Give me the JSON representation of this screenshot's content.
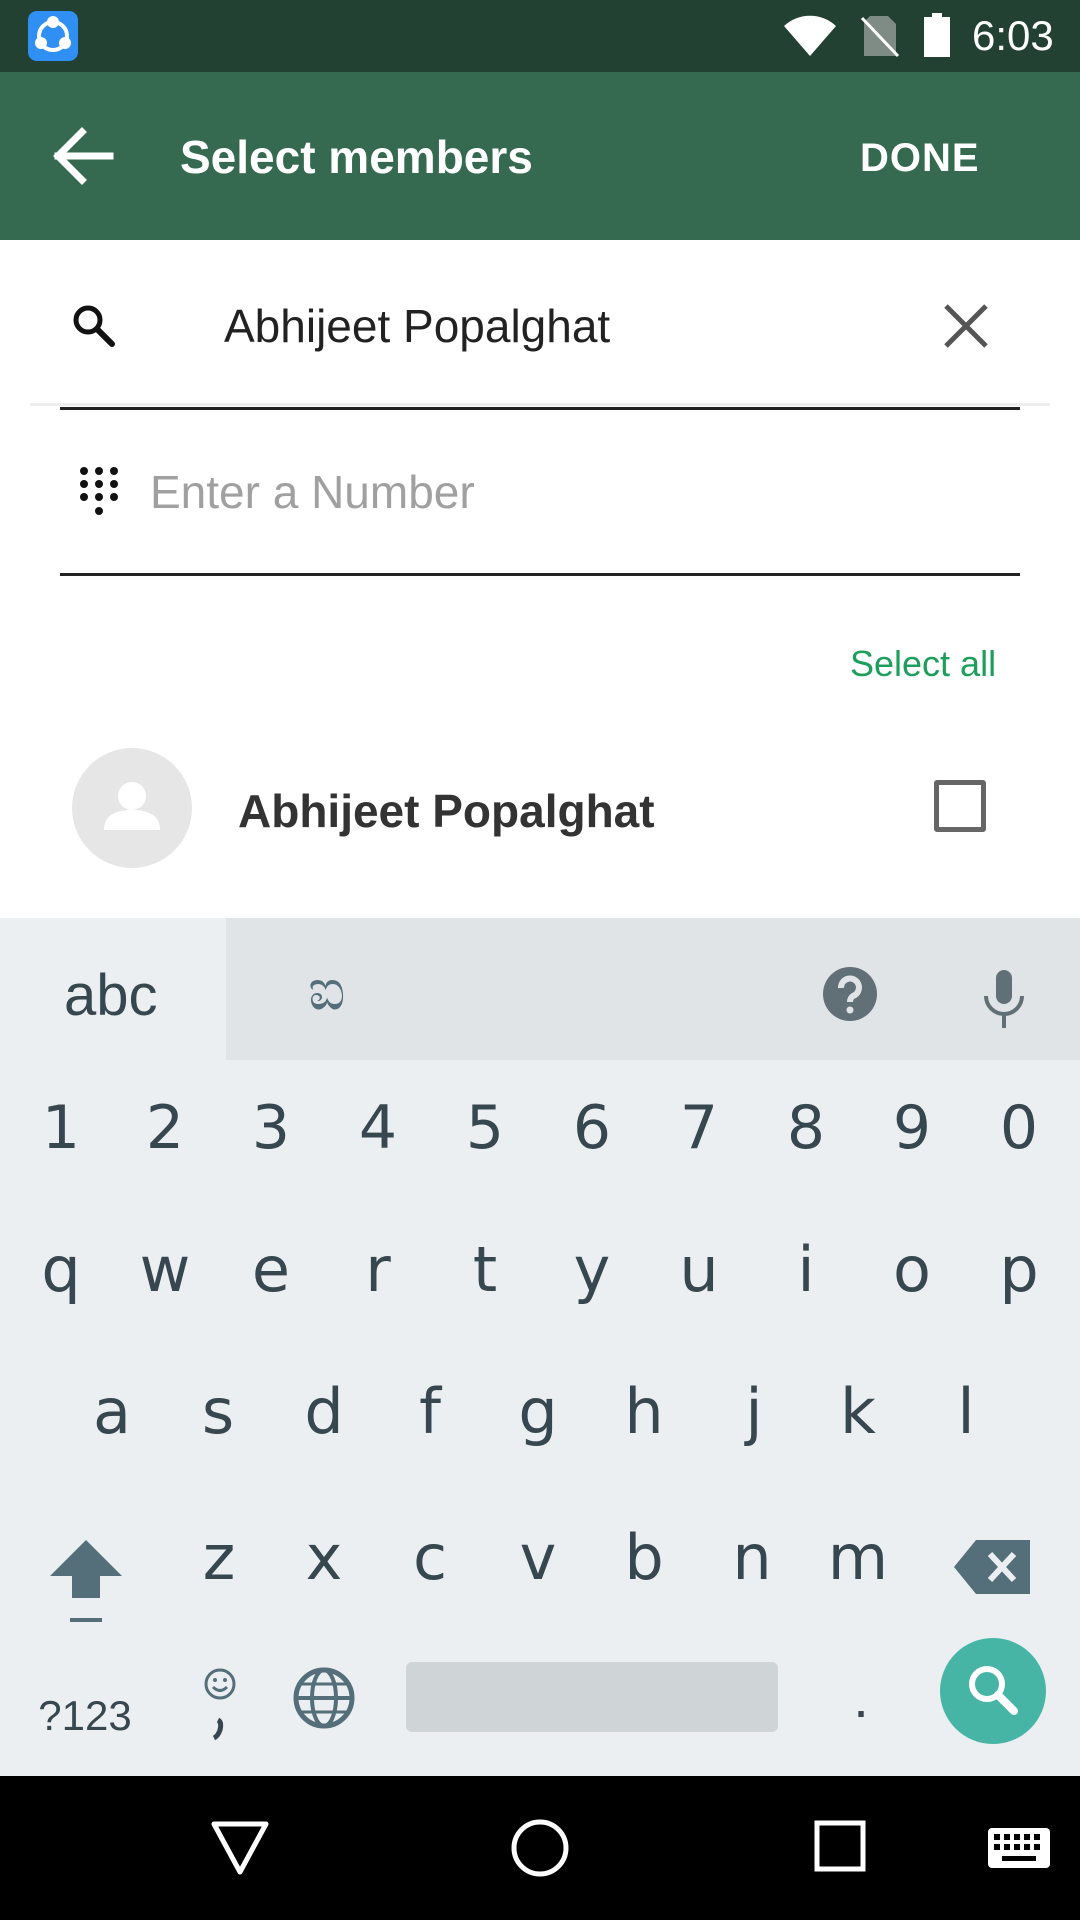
{
  "status_bar": {
    "time": "6:03",
    "icons": [
      "shareit-app-icon",
      "wifi-icon",
      "no-sim-icon",
      "battery-icon"
    ]
  },
  "app_bar": {
    "title": "Select members",
    "done_label": "DONE",
    "back_icon": "arrow-back-icon",
    "color": "#356a50"
  },
  "search": {
    "value": "Abhijeet Popalghat",
    "icon": "search-icon",
    "clear_icon": "close-icon"
  },
  "number_field": {
    "placeholder": "Enter a Number",
    "icon": "dialpad-icon"
  },
  "select_all_label": "Select all",
  "contacts": [
    {
      "name": "Abhijeet Popalghat",
      "checked": false
    }
  ],
  "keyboard": {
    "tabs": [
      "abc",
      "ಐ"
    ],
    "toolbar_icons": [
      "help-icon",
      "mic-icon"
    ],
    "rows": [
      [
        "1",
        "2",
        "3",
        "4",
        "5",
        "6",
        "7",
        "8",
        "9",
        "0"
      ],
      [
        "q",
        "w",
        "e",
        "r",
        "t",
        "y",
        "u",
        "i",
        "o",
        "p"
      ],
      [
        "a",
        "s",
        "d",
        "f",
        "g",
        "h",
        "j",
        "k",
        "l"
      ],
      [
        "z",
        "x",
        "c",
        "v",
        "b",
        "n",
        "m"
      ]
    ],
    "symbols_label": "?123",
    "period_label": ".",
    "action_icon": "search-icon",
    "accent": "#47b5a6"
  },
  "nav_bar": {
    "icons": [
      "nav-back-icon",
      "nav-home-icon",
      "nav-recents-icon",
      "keyboard-switch-icon"
    ]
  }
}
